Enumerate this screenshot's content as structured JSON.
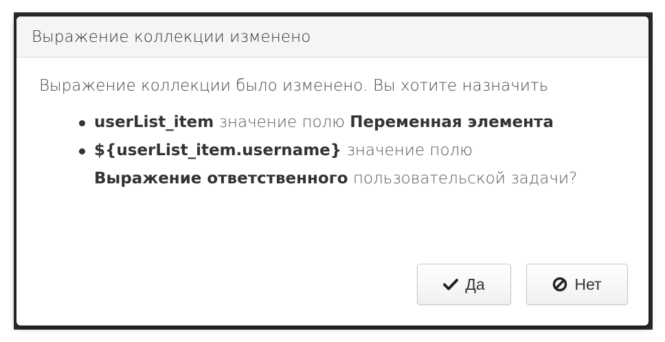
{
  "dialog": {
    "title": "Выражение коллекции изменено",
    "intro": "Выражение коллекции было изменено. Вы хотите назначить",
    "items": [
      {
        "value": "userList_item",
        "text1": " значение полю ",
        "field": "Переменная элемента",
        "text2": ""
      },
      {
        "value": "${userList_item.username}",
        "text1": " значение полю ",
        "field": "Выражение ответственного",
        "text2": " пользовательской задачи?"
      }
    ],
    "buttons": {
      "yes": {
        "label": "Да",
        "icon": "check-icon"
      },
      "no": {
        "label": "Нет",
        "icon": "ban-icon"
      }
    }
  }
}
